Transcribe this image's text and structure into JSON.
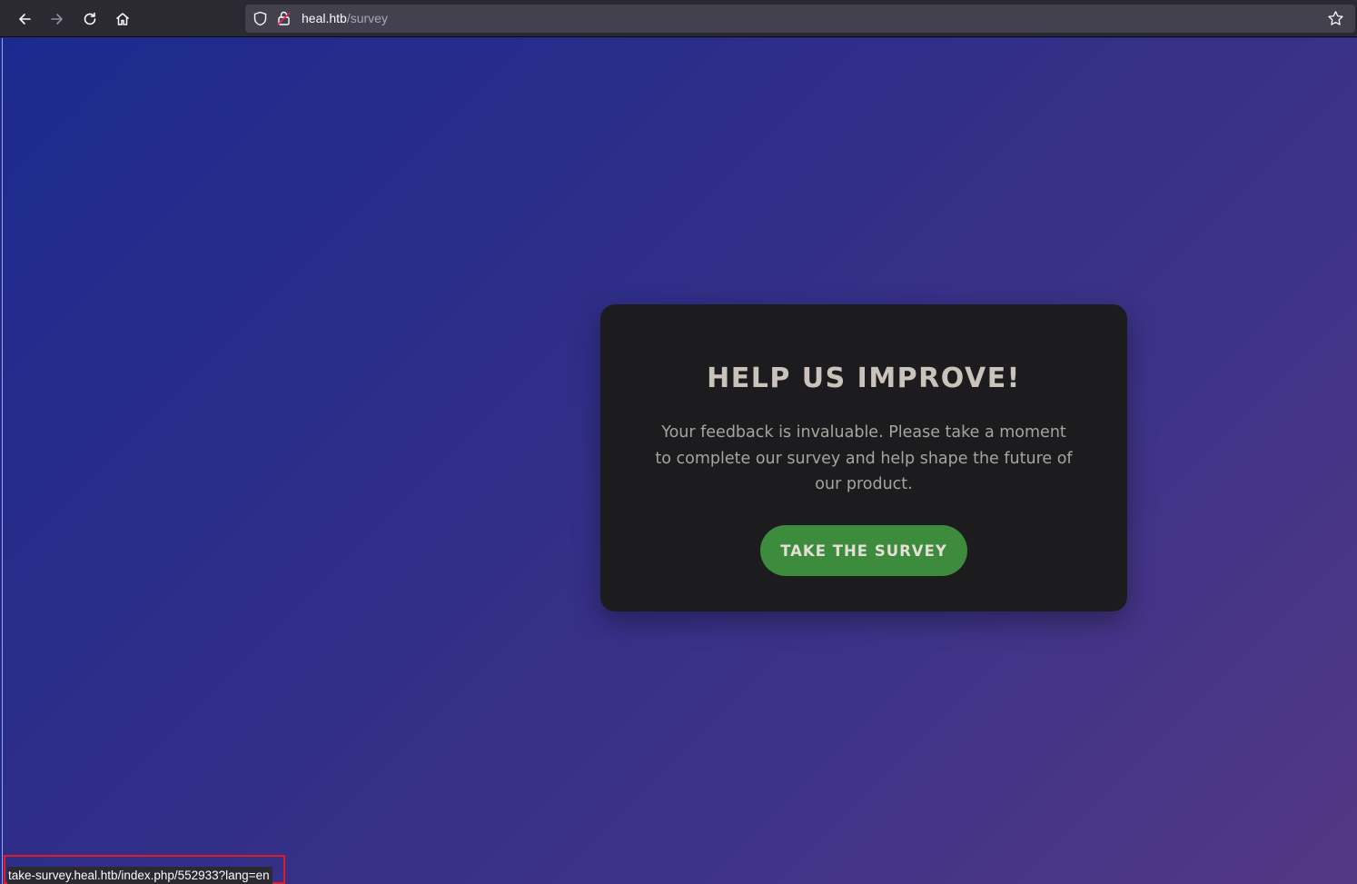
{
  "browser": {
    "url_host": "heal.htb",
    "url_path": "/survey",
    "icons": {
      "back": "back-arrow-icon",
      "forward": "forward-arrow-icon",
      "reload": "reload-icon",
      "home": "home-icon",
      "shield": "tracking-shield-icon",
      "lock": "insecure-lock-icon",
      "bookmark": "bookmark-star-icon"
    }
  },
  "page": {
    "background_colors": [
      "#1c2a8f",
      "#533884"
    ],
    "card": {
      "title": "HELP US IMPROVE!",
      "text": "Your feedback is invaluable. Please take a moment to complete our survey and help shape the future of our product.",
      "button_label": "TAKE THE SURVEY",
      "button_color": "#3d8b3d"
    }
  },
  "status_bar": {
    "link_url": "take-survey.heal.htb/index.php/552933?lang=en",
    "highlight_color": "#e01b24"
  }
}
